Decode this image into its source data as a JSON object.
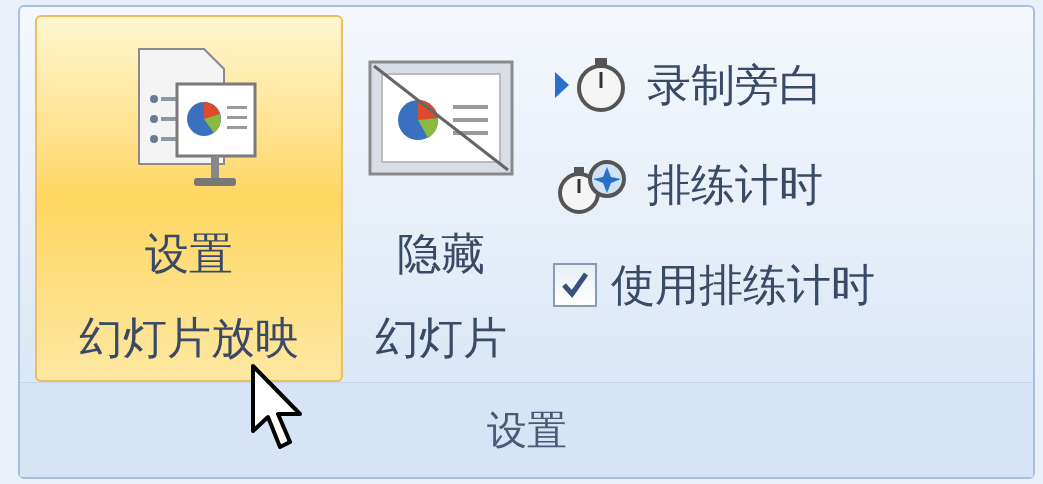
{
  "group": {
    "label": "设置",
    "large_buttons": [
      {
        "kind": "setup",
        "lines": [
          "设置",
          "幻灯片放映"
        ],
        "highlighted": true
      },
      {
        "kind": "hide",
        "lines": [
          "隐藏",
          "幻灯片"
        ],
        "highlighted": false
      }
    ],
    "small_items": [
      {
        "kind": "record",
        "label": "录制旁白"
      },
      {
        "kind": "rehearse",
        "label": "排练计时"
      },
      {
        "kind": "checkbox",
        "label": "使用排练计时",
        "checked": true
      }
    ]
  }
}
